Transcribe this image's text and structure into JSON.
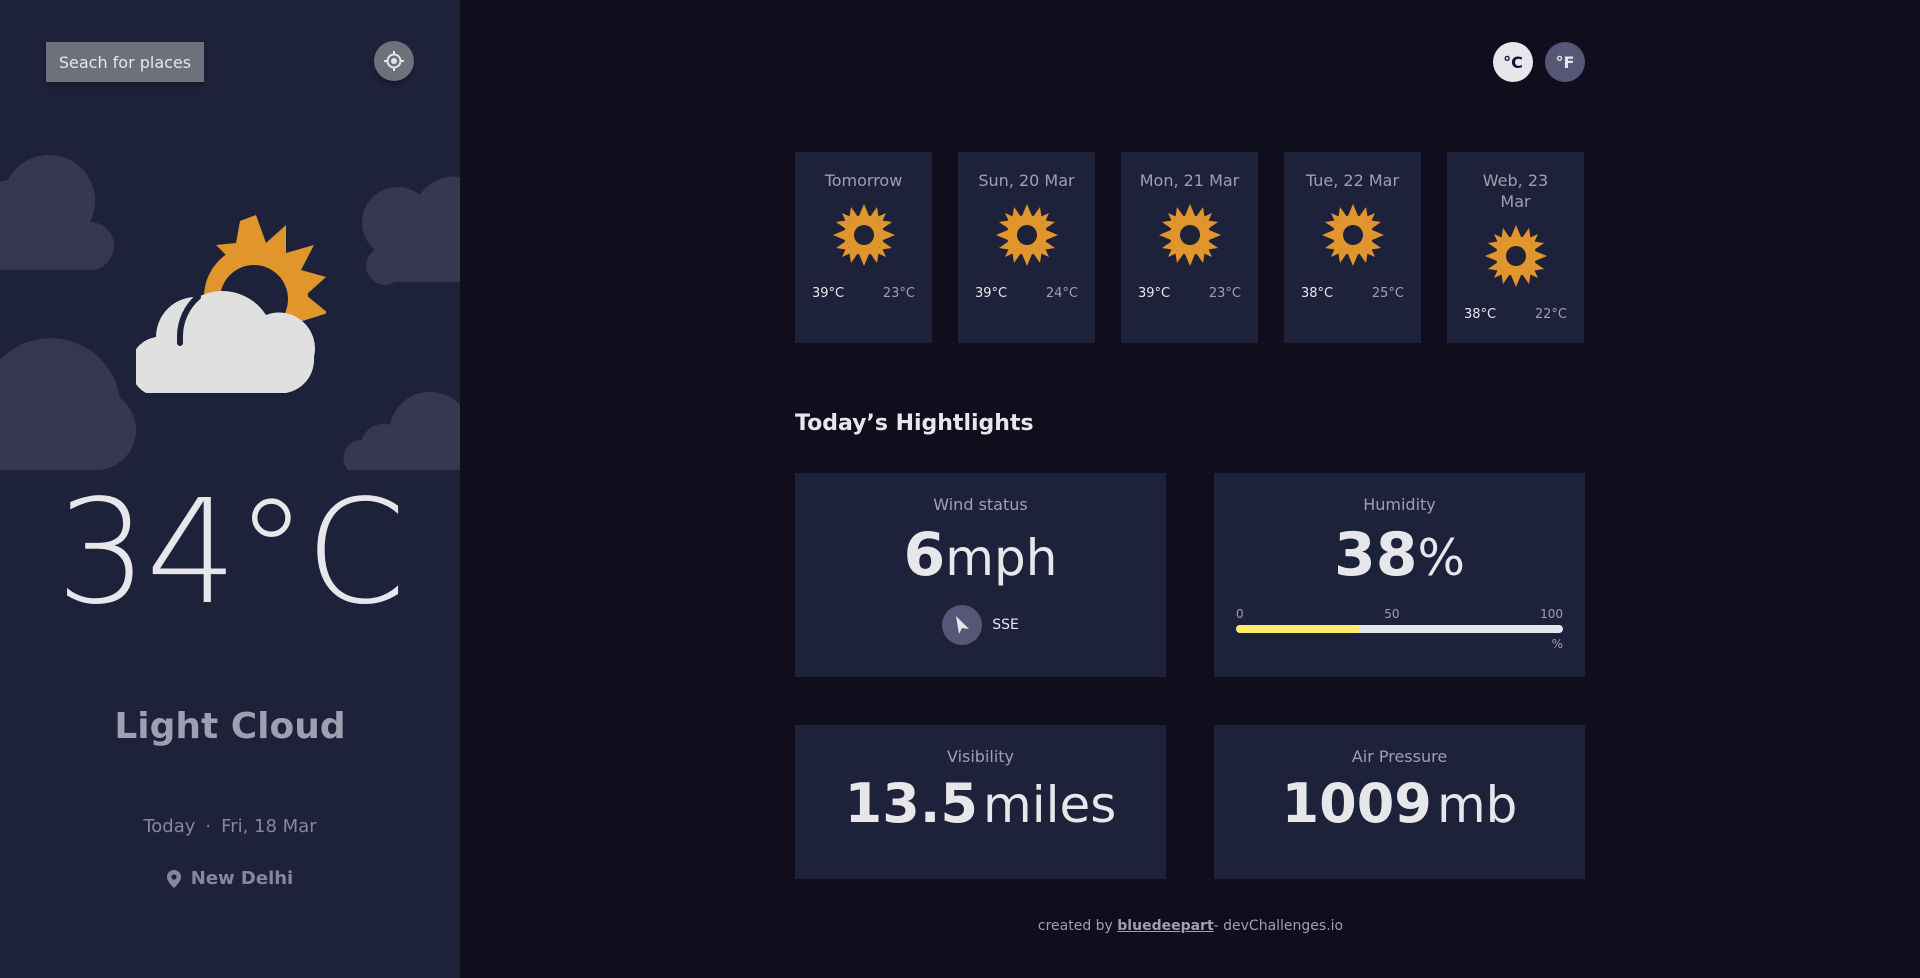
{
  "sidebar": {
    "search_label": "Seach for places",
    "temperature": "34",
    "temperature_unit": "°C",
    "condition": "Light Cloud",
    "today_label": "Today",
    "date": "Fri, 18 Mar",
    "location": "New Delhi"
  },
  "units": {
    "celsius": "°C",
    "fahrenheit": "°F",
    "active": "celsius"
  },
  "forecast": [
    {
      "day": "Tomorrow",
      "high": "39°C",
      "low": "23°C",
      "icon": "sun-icon"
    },
    {
      "day": "Sun, 20 Mar",
      "high": "39°C",
      "low": "24°C",
      "icon": "sun-icon"
    },
    {
      "day": "Mon, 21 Mar",
      "high": "39°C",
      "low": "23°C",
      "icon": "sun-icon"
    },
    {
      "day": "Tue, 22 Mar",
      "high": "38°C",
      "low": "25°C",
      "icon": "sun-icon"
    },
    {
      "day": "Web, 23 Mar",
      "high": "38°C",
      "low": "22°C",
      "icon": "sun-icon"
    }
  ],
  "highlights": {
    "title": "Today’s Hightlights",
    "wind": {
      "label": "Wind status",
      "value": "6",
      "unit": "mph",
      "direction": "SSE"
    },
    "humidity": {
      "label": "Humidity",
      "value": "38",
      "unit": "%",
      "scale_min": "0",
      "scale_mid": "50",
      "scale_max": "100",
      "scale_unit": "%",
      "level_percent": 38
    },
    "visibility": {
      "label": "Visibility",
      "value": "13.5",
      "unit": "miles"
    },
    "pressure": {
      "label": "Air Pressure",
      "value": "1009",
      "unit": "mb"
    }
  },
  "footer": {
    "prefix": "created by ",
    "author": "bluedeepart",
    "suffix": "- devChallenges.io"
  },
  "colors": {
    "sidebar_bg": "#1e213a",
    "page_bg": "#100e1d",
    "card_bg": "#1e213a",
    "sun": "#e0962d",
    "humidity_bar": "#ffec65",
    "text": "#e7e7eb",
    "muted": "#a09fb1"
  }
}
